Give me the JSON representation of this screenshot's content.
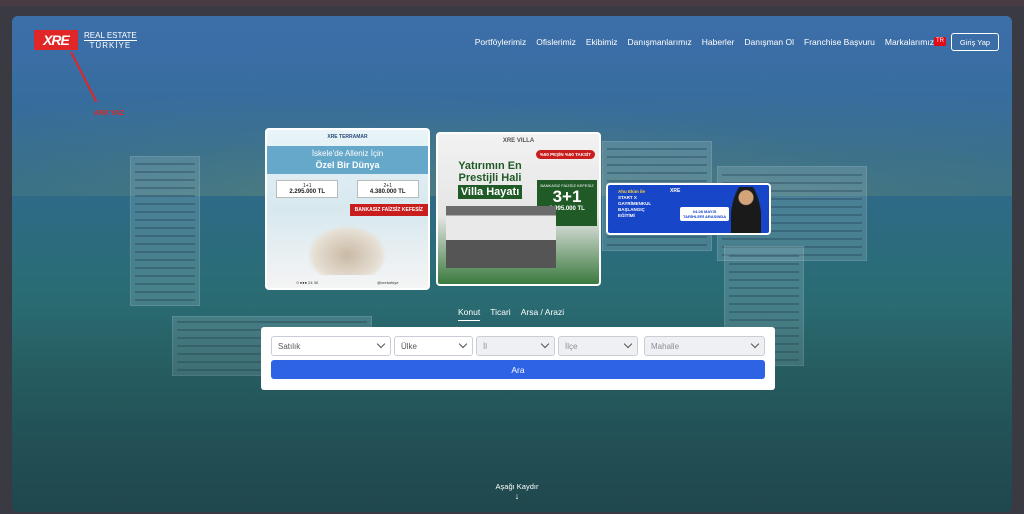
{
  "brand": {
    "mark": "XRE",
    "line1": "REAL ESTATE",
    "line2": "TÜRKİYE"
  },
  "annotation": {
    "note": "ARX YAZ"
  },
  "nav": {
    "items": [
      "Portföylerimiz",
      "Ofislerimiz",
      "Ekibimiz",
      "Danışmanlarımız",
      "Haberler",
      "Danışman Ol",
      "Franchise Başvuru",
      "Markalarımız"
    ],
    "language_flag": "TR",
    "login_label": "Giriş Yap"
  },
  "banners": {
    "b1": {
      "brand": "XRE TERRAMAR",
      "heading1": "İskele'de Alleniz İçin",
      "heading2": "Özel Bir Dünya",
      "price1_type": "1+1",
      "price1_value": "2.295.000 TL",
      "price2_type": "2+1",
      "price2_value": "4.380.000 TL",
      "tag": "BANKASIZ FAİZSİZ KEFESİZ",
      "foot_phone": "0 ●●● 24 30",
      "foot_handle": "@xreturkiye"
    },
    "b2": {
      "brand": "XRE VILLA",
      "pill": "%50 PEŞİN %50 TAKSİT",
      "title1": "Yatırımın En",
      "title2": "Prestijli Hali",
      "title3": "Villa Hayatı",
      "offer_sub": "BANKASIZ FAİZSİZ KEFESİZ",
      "offer_big": "3+1",
      "offer_price": "6.995.000 TL"
    },
    "b3": {
      "line1": "Ahu Ekim ile",
      "line2": "START X",
      "line3": "GAYRİMENKUL",
      "line4": "BAŞLANGIÇ",
      "line5": "EĞİTİMİ",
      "logo": "XRE",
      "dates1": "04-08 MAYIS",
      "dates2": "TARİHLERİ ARASINDA"
    }
  },
  "search": {
    "tabs": [
      "Konut",
      "Ticari",
      "Arsa / Arazi"
    ],
    "active_tab": "Konut",
    "type": "Satılık",
    "country": "Ülke",
    "city": "İl",
    "district": "İlçe",
    "neighborhood": "Mahalle",
    "submit_label": "Ara"
  },
  "scroll_hint": {
    "label": "Aşağı Kaydır",
    "arrow": "↓"
  }
}
